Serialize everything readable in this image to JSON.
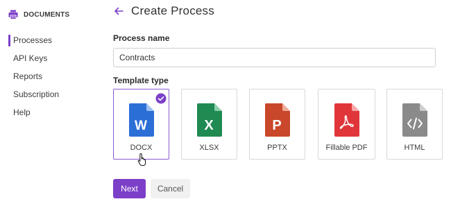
{
  "sidebar": {
    "brand": "DOCUMENTS",
    "items": [
      {
        "label": "Processes",
        "active": true
      },
      {
        "label": "API Keys",
        "active": false
      },
      {
        "label": "Reports",
        "active": false
      },
      {
        "label": "Subscription",
        "active": false
      },
      {
        "label": "Help",
        "active": false
      }
    ]
  },
  "header": {
    "title": "Create Process",
    "back_icon": "arrow-left-icon"
  },
  "form": {
    "process_name_label": "Process name",
    "process_name_value": "Contracts",
    "template_type_label": "Template type",
    "templates": [
      {
        "label": "DOCX",
        "icon": "word-file-icon",
        "letter": "W",
        "color": "#2b6fd6",
        "selected": true
      },
      {
        "label": "XLSX",
        "icon": "excel-file-icon",
        "letter": "X",
        "color": "#1f8a52",
        "selected": false
      },
      {
        "label": "PPTX",
        "icon": "powerpoint-file-icon",
        "letter": "P",
        "color": "#c9472a",
        "selected": false
      },
      {
        "label": "Fillable PDF",
        "icon": "pdf-file-icon",
        "letter": "",
        "color": "#e0363a",
        "selected": false
      },
      {
        "label": "HTML",
        "icon": "code-file-icon",
        "letter": "</>",
        "color": "#8a8a8a",
        "selected": false
      }
    ]
  },
  "actions": {
    "next_label": "Next",
    "cancel_label": "Cancel"
  },
  "colors": {
    "accent": "#7b3fc8"
  }
}
